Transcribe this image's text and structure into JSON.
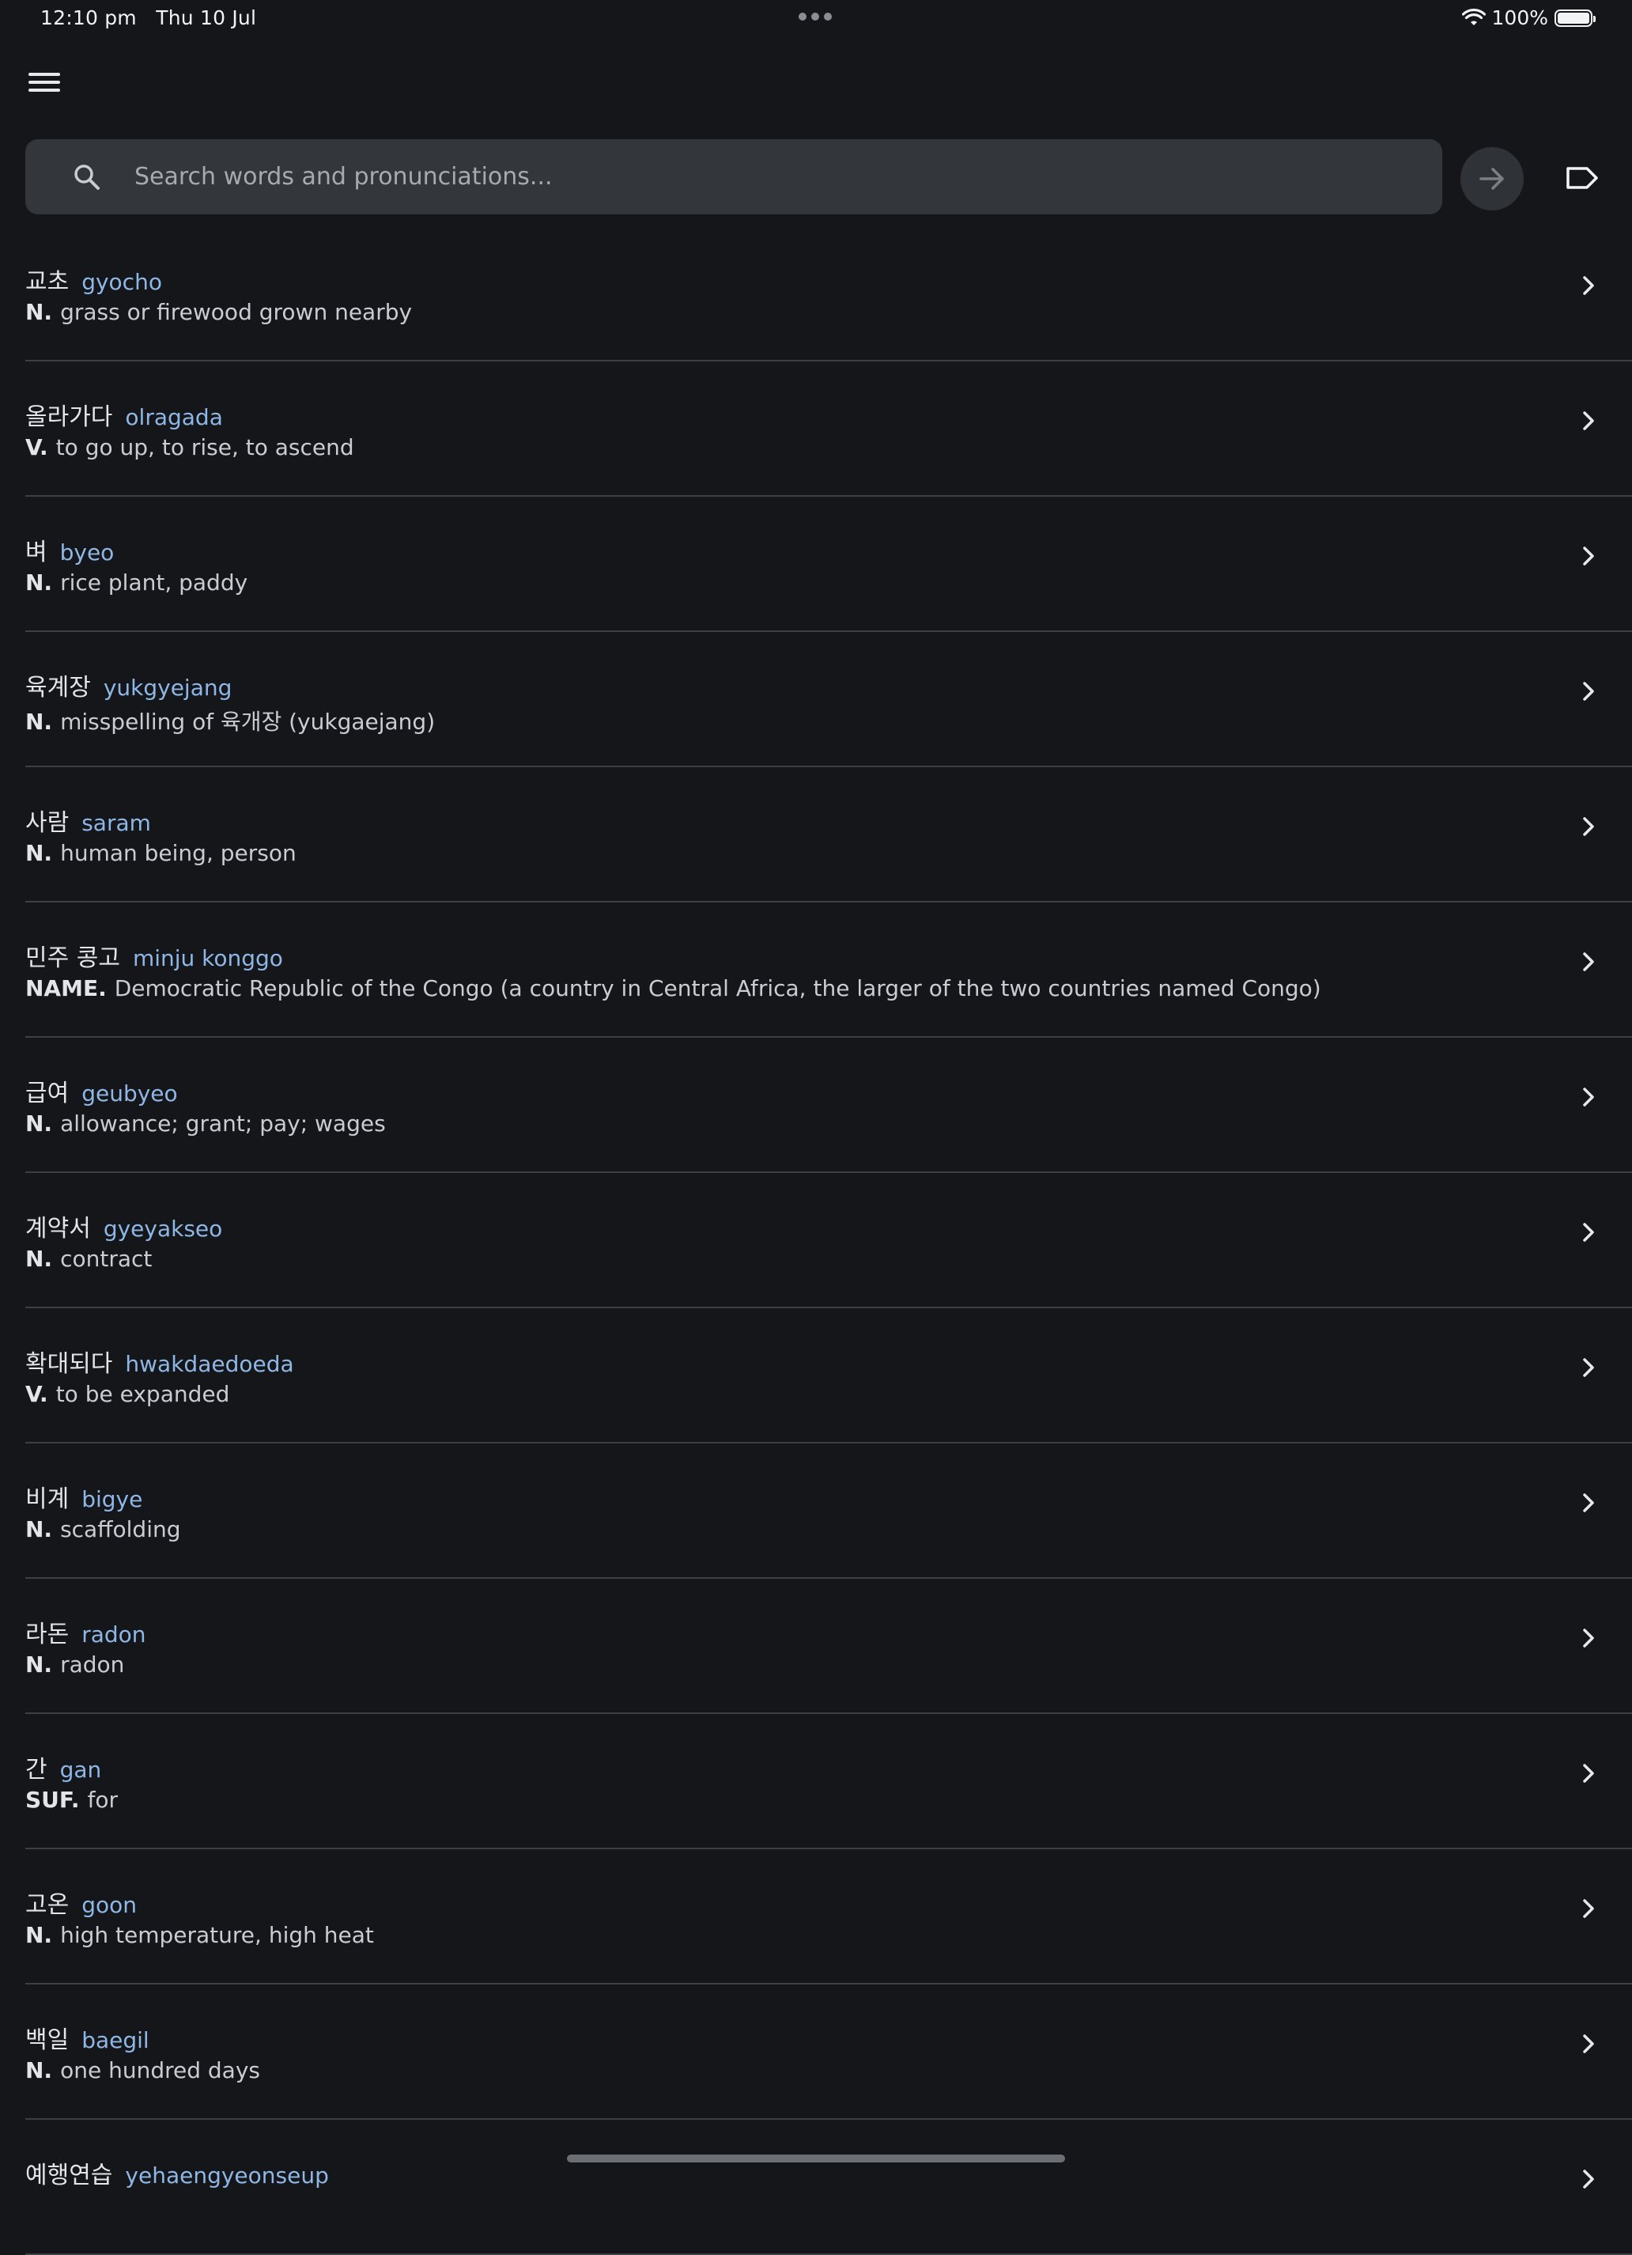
{
  "status_bar": {
    "time": "12:10 pm",
    "date": "Thu 10 Jul",
    "battery": "100%",
    "icons": [
      "wifi-icon",
      "battery-icon"
    ]
  },
  "header": {
    "menu_icon": "hamburger-menu-icon"
  },
  "search": {
    "placeholder": "Search words and pronunciations...",
    "value": "",
    "icon": "search-icon",
    "go_icon": "arrow-right-icon",
    "label_icon": "label-tag-icon"
  },
  "words": [
    {
      "hangul": "교초",
      "roman": "gyocho",
      "pos": "N.",
      "definition": "grass or firewood grown nearby"
    },
    {
      "hangul": "올라가다",
      "roman": "olragada",
      "pos": "V.",
      "definition": "to go up, to rise, to ascend"
    },
    {
      "hangul": "벼",
      "roman": "byeo",
      "pos": "N.",
      "definition": "rice plant, paddy"
    },
    {
      "hangul": "육계장",
      "roman": "yukgyejang",
      "pos": "N.",
      "definition": "misspelling of 육개장 (yukgaejang)"
    },
    {
      "hangul": "사람",
      "roman": "saram",
      "pos": "N.",
      "definition": "human being, person"
    },
    {
      "hangul": "민주 콩고",
      "roman": "minju konggo",
      "pos": "NAME.",
      "definition": "Democratic Republic of the Congo (a country in Central Africa, the larger of the two countries named Congo)"
    },
    {
      "hangul": "급여",
      "roman": "geubyeo",
      "pos": "N.",
      "definition": "allowance; grant; pay; wages"
    },
    {
      "hangul": "계약서",
      "roman": "gyeyakseo",
      "pos": "N.",
      "definition": "contract"
    },
    {
      "hangul": "확대되다",
      "roman": "hwakdaedoeda",
      "pos": "V.",
      "definition": "to be expanded"
    },
    {
      "hangul": "비계",
      "roman": "bigye",
      "pos": "N.",
      "definition": "scaffolding"
    },
    {
      "hangul": "라돈",
      "roman": "radon",
      "pos": "N.",
      "definition": "radon"
    },
    {
      "hangul": "간",
      "roman": "gan",
      "pos": "SUF.",
      "definition": "for"
    },
    {
      "hangul": "고온",
      "roman": "goon",
      "pos": "N.",
      "definition": "high temperature, high heat"
    },
    {
      "hangul": "백일",
      "roman": "baegil",
      "pos": "N.",
      "definition": "one hundred days"
    },
    {
      "hangul": "예행연습",
      "roman": "yehaengyeonseup",
      "pos": "",
      "definition": ""
    }
  ],
  "colors": {
    "background": "#141619",
    "search_bg": "#33363b",
    "romanization": "#8fb7e6",
    "divider": "#3c3f44"
  }
}
